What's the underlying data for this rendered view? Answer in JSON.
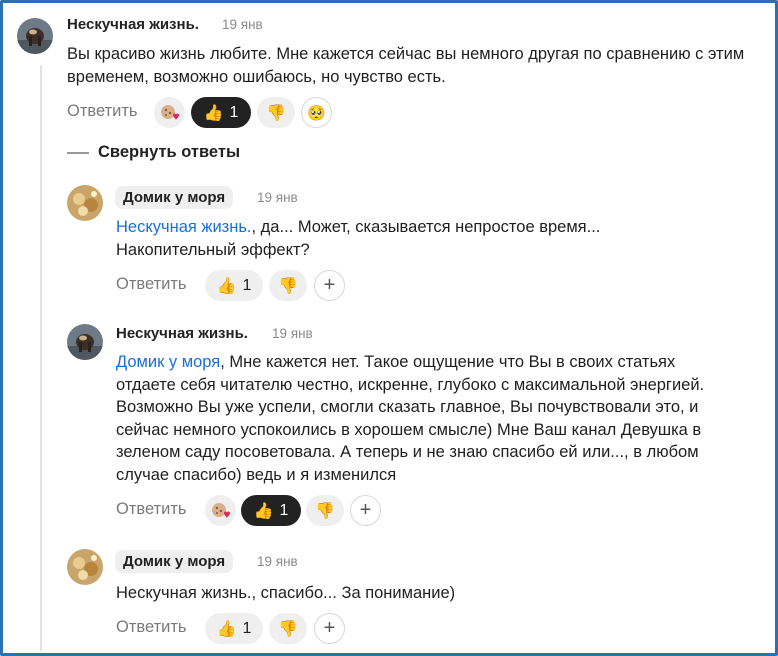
{
  "comments": [
    {
      "author": "Нескучная жизнь.",
      "date": "19 янв",
      "text": "Вы красиво жизнь любите. Мне кажется сейчас вы немного другая по сравнению с этим временем, возможно ошибаюсь, но чувство есть.",
      "reply_label": "Ответить",
      "like_count": "1"
    },
    {
      "author": "Домик у моря",
      "date": "19 янв",
      "mention": "Нескучная жизнь.",
      "text": ", да... Может, сказывается непростое время... Накопительный эффект?",
      "reply_label": "Ответить",
      "like_count": "1"
    },
    {
      "author": "Нескучная жизнь.",
      "date": "19 янв",
      "mention": "Домик у моря",
      "text": ", Мне кажется нет. Такое ощущение что Вы в своих статьях отдаете себя читателю честно, искренне, глубоко с максимальной энергией. Возможно Вы уже успели, смогли сказать главное, Вы почувствовали это, и сейчас немного успокоились в хорошем смысле) Мне Ваш канал Девушка в зеленом саду посоветовала. А теперь и не знаю спасибо ей или..., в любом случае спасибо) ведь и я изменился",
      "reply_label": "Ответить",
      "like_count": "1"
    },
    {
      "author": "Домик у моря",
      "date": "19 янв",
      "text": "Нескучная жизнь., спасибо... За понимание)",
      "reply_label": "Ответить",
      "like_count": "1"
    }
  ],
  "collapse_label": "Свернуть ответы",
  "icons": {
    "like": "thumbs-up-icon",
    "dislike": "thumbs-down-icon",
    "heart": "heart-cookie-icon",
    "add": "plus-icon",
    "smiley": "pleading-face-icon"
  },
  "colors": {
    "border": "#2d6fb3",
    "mention": "#1a6fd8",
    "chip_active": "#222222"
  }
}
